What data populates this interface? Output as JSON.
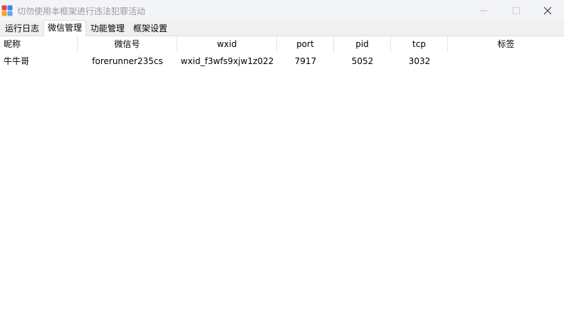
{
  "window": {
    "title": "切勿使用本框架进行违法犯罪活动"
  },
  "tabs": [
    {
      "label": "运行日志",
      "active": false
    },
    {
      "label": "微信管理",
      "active": true
    },
    {
      "label": "功能管理",
      "active": false
    },
    {
      "label": "框架设置",
      "active": false
    }
  ],
  "table": {
    "columns": [
      "昵称",
      "微信号",
      "wxid",
      "port",
      "pid",
      "tcp",
      "标签"
    ],
    "rows": [
      {
        "nickname": "牛牛哥",
        "wechat_id": "forerunner235cs",
        "wxid": "wxid_f3wfs9xjw1z022",
        "port": "7917",
        "pid": "5052",
        "tcp": "3032",
        "tag": ""
      }
    ]
  },
  "icons": {
    "app": "app-logo-icon",
    "minimize": "minimize-icon",
    "maximize": "maximize-icon",
    "close": "close-icon"
  },
  "colors": {
    "titlebar_bg": "#f3f4f8",
    "title_text": "#9a9a9a",
    "tabbar_bg": "#f0f0f0",
    "logo_red": "#e8453c",
    "logo_blue": "#3b82f6",
    "logo_orange": "#f5a623",
    "logo_lightblue": "#60a5fa"
  }
}
